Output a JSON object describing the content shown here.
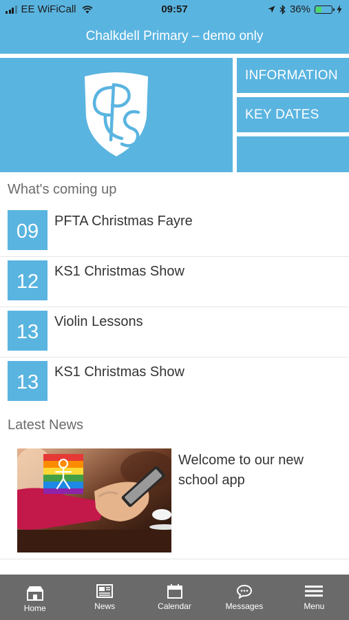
{
  "status_bar": {
    "carrier": "EE WiFiCall",
    "time": "09:57",
    "battery_percent": "36%",
    "battery_level": 0.36
  },
  "header": {
    "title": "Chalkdell Primary – demo only"
  },
  "hero": {
    "logo_icon": "school-crest-icon",
    "tiles": [
      {
        "label": "INFORMATION"
      },
      {
        "label": "KEY DATES"
      },
      {
        "label": ""
      }
    ]
  },
  "events": {
    "heading": "What's coming up",
    "items": [
      {
        "day": "09",
        "title": "PFTA Christmas Fayre"
      },
      {
        "day": "12",
        "title": "KS1 Christmas Show"
      },
      {
        "day": "13",
        "title": "Violin Lessons"
      },
      {
        "day": "13",
        "title": "KS1 Christmas Show"
      }
    ]
  },
  "news": {
    "heading": "Latest News",
    "items": [
      {
        "title": "Welcome to our new school app",
        "image": "hand-holding-smartphone-photo"
      }
    ]
  },
  "bottom_nav": {
    "items": [
      {
        "label": "Home",
        "icon": "home-icon"
      },
      {
        "label": "News",
        "icon": "news-icon"
      },
      {
        "label": "Calendar",
        "icon": "calendar-icon"
      },
      {
        "label": "Messages",
        "icon": "messages-icon"
      },
      {
        "label": "Menu",
        "icon": "menu-icon"
      }
    ]
  },
  "colors": {
    "accent": "#5ab4e0",
    "nav_background": "#6a6a6a",
    "battery_fill": "#4cd964"
  }
}
